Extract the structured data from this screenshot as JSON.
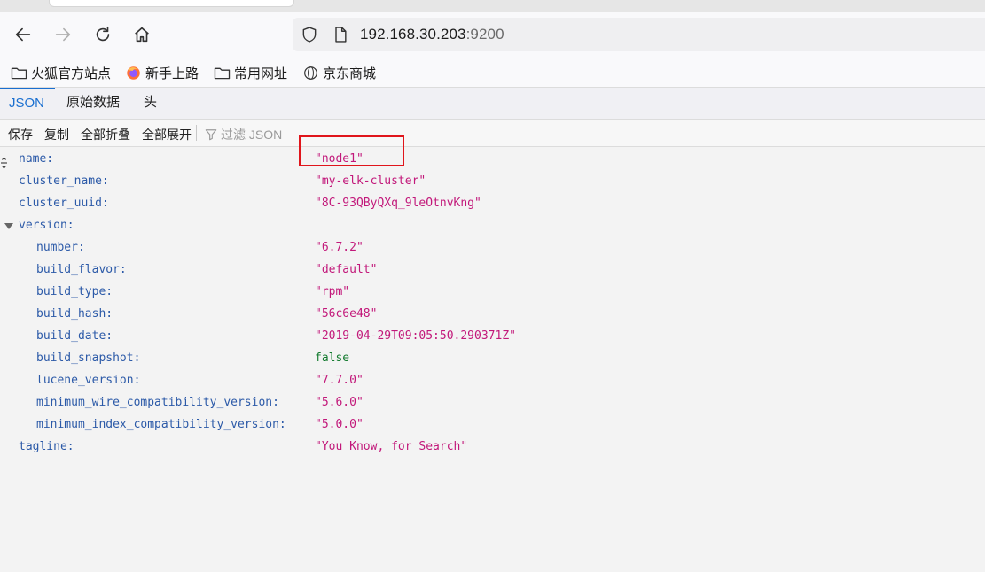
{
  "browser": {
    "url_host": "192.168.30.203",
    "url_port": ":9200"
  },
  "bookmarks": [
    {
      "label": "火狐官方站点",
      "icon": "folder-icon"
    },
    {
      "label": "新手上路",
      "icon": "firefox-icon"
    },
    {
      "label": "常用网址",
      "icon": "folder-icon"
    },
    {
      "label": "京东商城",
      "icon": "globe-icon"
    }
  ],
  "viewer_tabs": [
    "JSON",
    "原始数据",
    "头"
  ],
  "toolbar": {
    "save": "保存",
    "copy": "复制",
    "collapse_all": "全部折叠",
    "expand_all": "全部展开",
    "filter_placeholder": "过滤 JSON"
  },
  "json": {
    "name": {
      "key": "name:",
      "value": "\"node1\""
    },
    "cluster_name": {
      "key": "cluster_name:",
      "value": "\"my-elk-cluster\""
    },
    "cluster_uuid": {
      "key": "cluster_uuid:",
      "value": "\"8C-93QByQXq_9leOtnvKng\""
    },
    "version": {
      "key": "version:",
      "number": {
        "key": "number:",
        "value": "\"6.7.2\""
      },
      "build_flavor": {
        "key": "build_flavor:",
        "value": "\"default\""
      },
      "build_type": {
        "key": "build_type:",
        "value": "\"rpm\""
      },
      "build_hash": {
        "key": "build_hash:",
        "value": "\"56c6e48\""
      },
      "build_date": {
        "key": "build_date:",
        "value": "\"2019-04-29T09:05:50.290371Z\""
      },
      "build_snapshot": {
        "key": "build_snapshot:",
        "value": "false"
      },
      "lucene_version": {
        "key": "lucene_version:",
        "value": "\"7.7.0\""
      },
      "minimum_wire_compatibility_version": {
        "key": "minimum_wire_compatibility_version:",
        "value": "\"5.6.0\""
      },
      "minimum_index_compatibility_version": {
        "key": "minimum_index_compatibility_version:",
        "value": "\"5.0.0\""
      }
    },
    "tagline": {
      "key": "tagline:",
      "value": "\"You Know, for Search\""
    }
  },
  "colors": {
    "key": "#2c5aa8",
    "string": "#c2187a",
    "boolean": "#137a2e",
    "active_tab": "#1a6fd0",
    "highlight_box": "#e0151b"
  }
}
